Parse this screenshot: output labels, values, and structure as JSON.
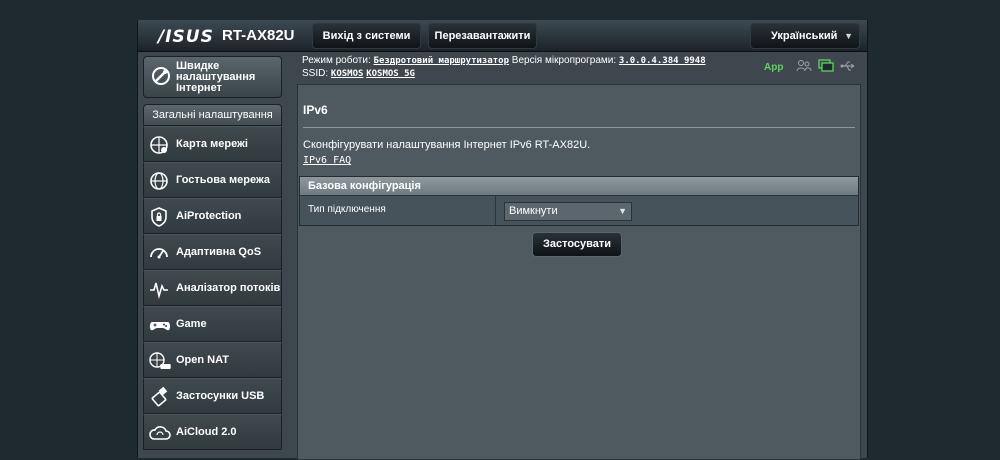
{
  "header": {
    "logo": "/ISUS",
    "model": "RT-AX82U",
    "logout_label": "Вихід з системи",
    "reboot_label": "Перезавантажити",
    "language": "Український"
  },
  "quick_setup": {
    "label": "Швидке налаштування Інтернет"
  },
  "sidebar": {
    "section_title": "Загальні налаштування",
    "items": [
      {
        "label": "Карта мережі",
        "icon": "network-map-icon"
      },
      {
        "label": "Гостьова мережа",
        "icon": "guest-network-icon"
      },
      {
        "label": "AiProtection",
        "icon": "shield-icon"
      },
      {
        "label": "Адаптивна QoS",
        "icon": "gauge-icon"
      },
      {
        "label": "Аналізатор потоків",
        "icon": "traffic-analyzer-icon"
      },
      {
        "label": "Game",
        "icon": "gamepad-icon"
      },
      {
        "label": "Open NAT",
        "icon": "open-nat-icon"
      },
      {
        "label": "Застосунки USB",
        "icon": "usb-icon"
      },
      {
        "label": "AiCloud 2.0",
        "icon": "cloud-icon"
      }
    ]
  },
  "status": {
    "mode_label": "Режим роботи:",
    "mode_value": "Бездротовий маршрутизатор",
    "fw_label": "Версія мікропрограми:",
    "fw_value": "3.0.0.4.384_9948",
    "ssid_label": "SSID:",
    "ssid_1": "KOSMOS",
    "ssid_2": "KOSMOS_5G",
    "app_label": "App",
    "accent_color": "#5fd35f"
  },
  "main": {
    "title": "IPv6",
    "description": "Сконфігурувати налаштування Інтернет IPv6 RT-AX82U.",
    "faq_link": "IPv6 FAQ",
    "table_header": "Базова конфігурація",
    "row_label": "Тип підключення",
    "select_value": "Вимкнути",
    "apply_label": "Застосувати"
  }
}
